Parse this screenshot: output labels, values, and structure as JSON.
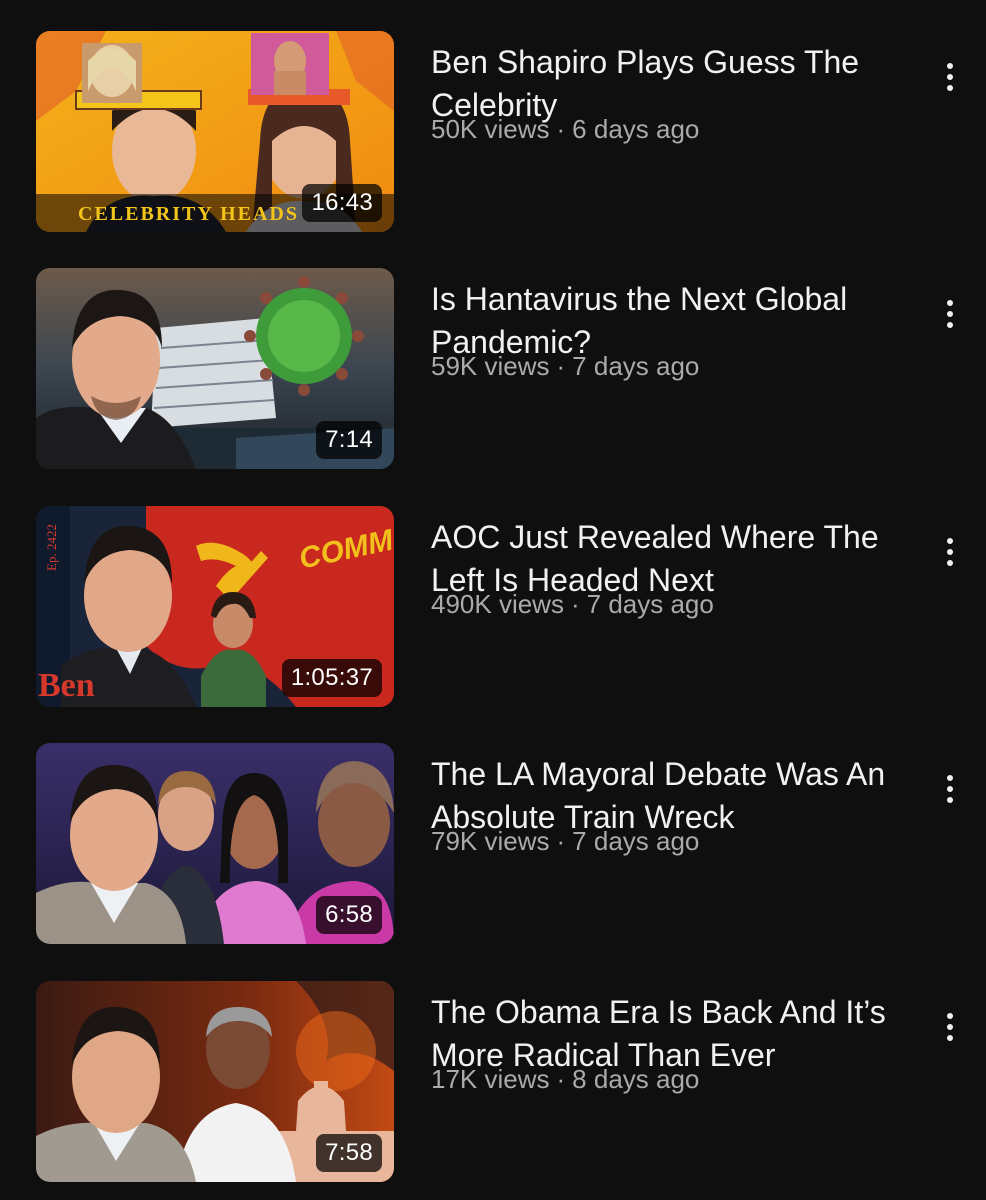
{
  "videos": [
    {
      "title": "Ben Shapiro Plays Guess The Celebrity",
      "views": "50K views",
      "age": "6 days ago",
      "duration": "16:43",
      "thumbnail_text": "CELEBRITY HEADS"
    },
    {
      "title": "Is Hantavirus the Next Global Pandemic?",
      "views": "59K views",
      "age": "7 days ago",
      "duration": "7:14"
    },
    {
      "title": "AOC Just Revealed Where The Left Is Headed Next",
      "views": "490K views",
      "age": "7 days ago",
      "duration": "1:05:37",
      "thumbnail_text": {
        "flag": "COMMIES UNITE!",
        "episode": "Ep. 2422",
        "brand": "Ben"
      }
    },
    {
      "title": "The LA Mayoral Debate Was An Absolute Train Wreck",
      "views": "79K views",
      "age": "7 days ago",
      "duration": "6:58"
    },
    {
      "title": "The Obama Era Is Back And It’s More Radical Than Ever",
      "views": "17K views",
      "age": "8 days ago",
      "duration": "7:58"
    }
  ],
  "separator": "·",
  "icons": {
    "more": "more-vert-icon"
  },
  "colors": {
    "background": "#0f0f0f",
    "title": "#f1f1f1",
    "meta": "#aaaaaa"
  }
}
